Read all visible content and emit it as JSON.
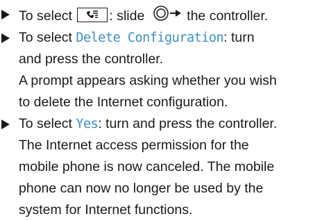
{
  "steps": [
    {
      "prefix": "To select",
      "key_icon": "phone-menu-key-icon",
      "colon": ":",
      "mid": " slide ",
      "controller_icon": "controller-slide-right-icon",
      "suffix": " the controller."
    },
    {
      "prefix": "To select ",
      "display_text": "Delete Configuration",
      "suffix_line1": ": turn",
      "line2": "and press the controller.",
      "result_line1": "A prompt appears asking whether you wish",
      "result_line2": "to delete the Internet configuration."
    },
    {
      "prefix": "To select ",
      "display_text": "Yes",
      "suffix_line1": ": turn and press the controller.",
      "result_line1": "The Internet access permission for the",
      "result_line2": "mobile phone is now canceled. The mobile",
      "result_line3": "phone can now no longer be used by the",
      "result_line4": "system for Internet functions."
    }
  ],
  "colors": {
    "text": "#1a1a1a",
    "display_text": "#3a8fc7"
  }
}
